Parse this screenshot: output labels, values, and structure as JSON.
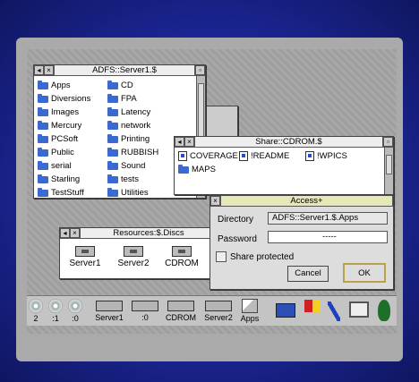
{
  "adfs_window": {
    "title": "ADFS::Server1.$",
    "col1": [
      "Apps",
      "Diversions",
      "Images",
      "Mercury",
      "PCSoft",
      "Public",
      "serial",
      "Starling",
      "TestStuff"
    ],
    "col2": [
      "CD",
      "FPA",
      "Latency",
      "network",
      "Printing",
      "RUBBISH",
      "Sound",
      "tests",
      "Utilities"
    ]
  },
  "share_window": {
    "title": "Share::CDROM.$",
    "items": [
      {
        "label": "COVERAGE",
        "kind": "file"
      },
      {
        "label": "!README",
        "kind": "file"
      },
      {
        "label": "!WPICS",
        "kind": "file"
      },
      {
        "label": "MAPS",
        "kind": "folder"
      }
    ]
  },
  "resources_window": {
    "title": "Resources:$.Discs",
    "items": [
      "Server1",
      "Server2",
      "CDROM"
    ]
  },
  "access_window": {
    "title": "Access+",
    "directory_label": "Directory",
    "directory_value": "ADFS::Server1.$.Apps",
    "password_label": "Password",
    "password_value": "-----",
    "share_protected_label": "Share protected",
    "cancel_label": "Cancel",
    "ok_label": "OK"
  },
  "iconbar": {
    "left": [
      {
        "label": "2",
        "icon": "cd-icon"
      },
      {
        "label": ":1",
        "icon": "cd-icon"
      },
      {
        "label": ":0",
        "icon": "cd-icon"
      },
      {
        "label": "Server1",
        "icon": "drive-icon"
      },
      {
        "label": ":0",
        "icon": "drive-icon"
      },
      {
        "label": "CDROM",
        "icon": "drive-icon"
      },
      {
        "label": "Server2",
        "icon": "drive-icon"
      },
      {
        "label": "Apps",
        "icon": "apps-icon"
      }
    ],
    "right": [
      "network-icon",
      "palette-icon",
      "pen-icon",
      "monitor-icon",
      "acorn-icon"
    ]
  }
}
